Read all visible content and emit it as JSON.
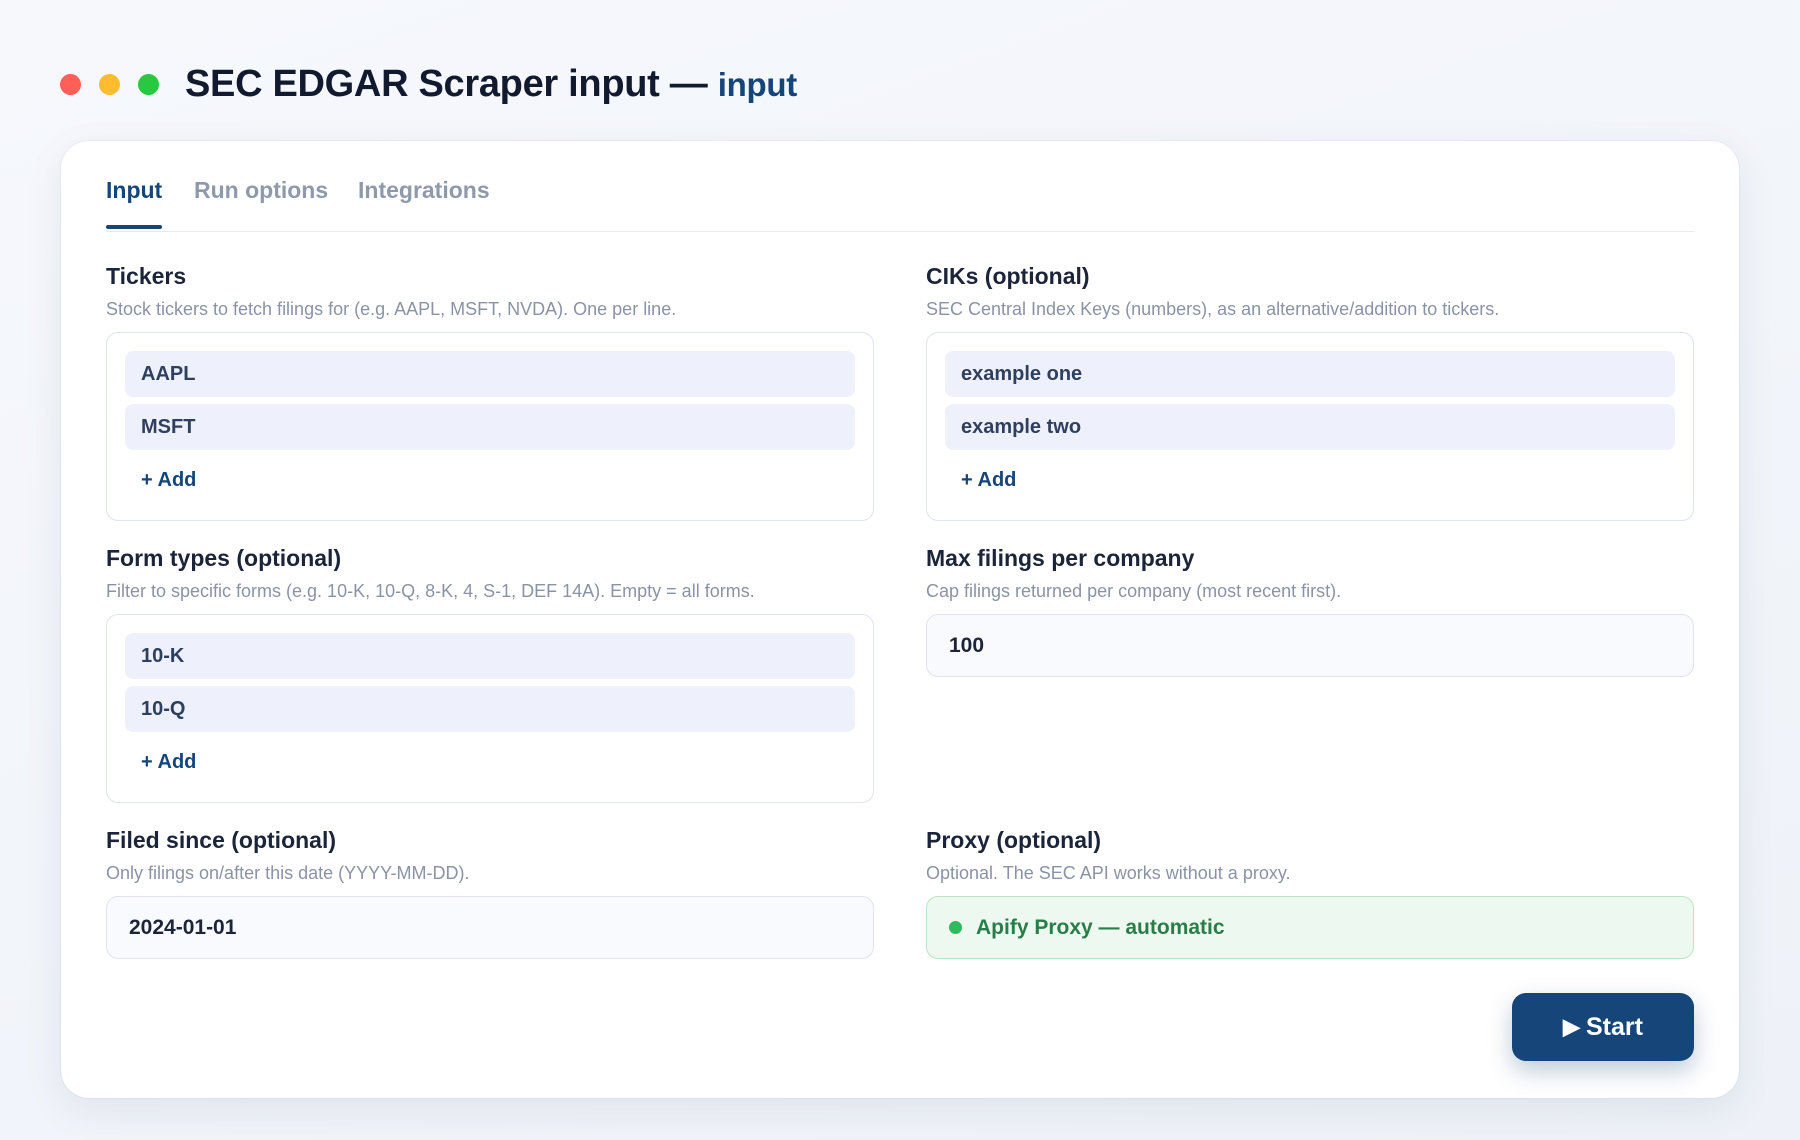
{
  "window": {
    "title": "SEC EDGAR Scraper input —",
    "title_suffix": "input"
  },
  "tabs": [
    {
      "label": "Input",
      "active": true
    },
    {
      "label": "Run options",
      "active": false
    },
    {
      "label": "Integrations",
      "active": false
    }
  ],
  "fields": {
    "tickers": {
      "label": "Tickers",
      "help": "Stock tickers to fetch filings for (e.g. AAPL, MSFT, NVDA). One per line.",
      "items": [
        "AAPL",
        "MSFT"
      ],
      "add_label": "+ Add"
    },
    "ciks": {
      "label": "CIKs (optional)",
      "help": "SEC Central Index Keys (numbers), as an alternative/addition to tickers.",
      "items": [
        "example one",
        "example two"
      ],
      "add_label": "+ Add"
    },
    "form_types": {
      "label": "Form types (optional)",
      "help": "Filter to specific forms (e.g. 10-K, 10-Q, 8-K, 4, S-1, DEF 14A). Empty = all forms.",
      "items": [
        "10-K",
        "10-Q"
      ],
      "add_label": "+ Add"
    },
    "max_filings": {
      "label": "Max filings per company",
      "help": "Cap filings returned per company (most recent first).",
      "value": "100"
    },
    "filed_since": {
      "label": "Filed since (optional)",
      "help": "Only filings on/after this date (YYYY-MM-DD).",
      "value": "2024-01-01"
    },
    "proxy": {
      "label": "Proxy (optional)",
      "help": "Optional. The SEC API works without a proxy.",
      "value": "Apify Proxy — automatic"
    }
  },
  "actions": {
    "start_icon": "▶",
    "start_label": "Start"
  },
  "colors": {
    "accent": "#16457a",
    "proxy_green": "#2dbb5d",
    "chip_bg": "#eef1fb"
  }
}
